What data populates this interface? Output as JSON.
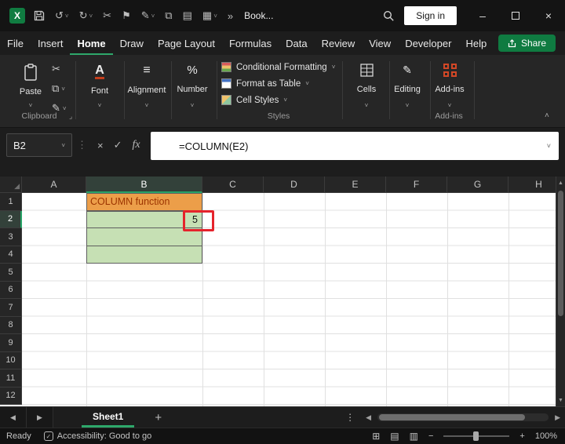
{
  "colors": {
    "accent_green": "#107C41",
    "tab_underline_green": "#2EA86B",
    "orange_fill": "#EC9E49",
    "orange_text": "#9C3400",
    "green_fill": "#C6E0B4",
    "annotation_red": "#E5232B"
  },
  "titlebar": {
    "logo": "X",
    "title": "Book...",
    "sign_in": "Sign in",
    "icons": {
      "undo": "↺",
      "redo": "↻",
      "cut": "✂",
      "flag": "⚑",
      "pen": "✎",
      "copy": "⧉",
      "chart": "▤",
      "grid": "▦",
      "overflow": "»",
      "chevron": "˅",
      "minimize": "–",
      "close": "×"
    }
  },
  "menubar": {
    "tabs": [
      "File",
      "Insert",
      "Home",
      "Draw",
      "Page Layout",
      "Formulas",
      "Data",
      "Review",
      "View",
      "Developer",
      "Help"
    ],
    "active_tab": "Home",
    "share": "Share"
  },
  "ribbon": {
    "paste": "Paste",
    "font": "Font",
    "font_icon": "A",
    "alignment": "Alignment",
    "alignment_icon": "≡",
    "number": "Number",
    "number_icon": "%",
    "styles_items": [
      "Conditional Formatting",
      "Format as Table",
      "Cell Styles"
    ],
    "cells": "Cells",
    "editing": "Editing",
    "editing_icon": "✎",
    "addins": "Add-ins",
    "groups": {
      "clipboard": "Clipboard",
      "styles": "Styles",
      "addins": "Add-ins"
    },
    "icons": {
      "cut": "✂",
      "copy": "⧉",
      "painter": "✎",
      "chevron": "˅",
      "collapse": "˄",
      "launcher": "⌟"
    }
  },
  "formula_bar": {
    "name_box": "B2",
    "dots": "⋮",
    "cancel": "×",
    "enter": "✓",
    "fx": "fx",
    "formula": "=COLUMN(E2)",
    "chevron": "˅"
  },
  "grid": {
    "columns": [
      "A",
      "B",
      "C",
      "D",
      "E",
      "F",
      "G",
      "H"
    ],
    "rows": [
      "1",
      "2",
      "3",
      "4",
      "5",
      "6",
      "7",
      "8",
      "9",
      "10",
      "11",
      "12"
    ],
    "selected_column": "B",
    "selected_row": "2",
    "selected_cell": "B2",
    "cells": {
      "B1": "COLUMN function",
      "B2": "5"
    },
    "corner": "◢",
    "scroll_up": "▲",
    "scroll_down": "▼"
  },
  "sheetbar": {
    "prev": "◀",
    "next": "▶",
    "tab": "Sheet1",
    "add": "+",
    "menu": "⋮",
    "scroll_left": "◀",
    "scroll_right": "▶"
  },
  "statusbar": {
    "ready": "Ready",
    "accessibility_check": "✓",
    "accessibility": "Accessibility: Good to go",
    "view_icons": [
      "⊞",
      "▤",
      "▥"
    ],
    "zoom_out": "−",
    "zoom_in": "+",
    "zoom": "100%"
  }
}
